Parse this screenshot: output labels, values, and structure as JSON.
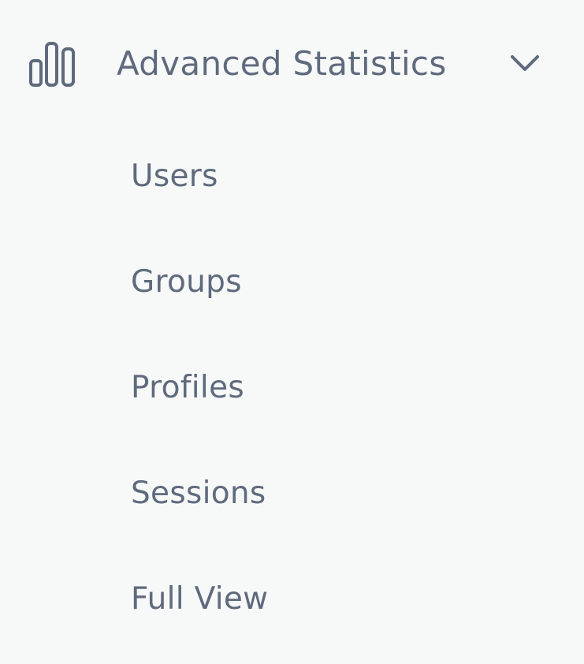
{
  "nav": {
    "section_title": "Advanced Statistics",
    "section_icon": "bar-chart-icon",
    "toggle_icon": "chevron-down-icon",
    "items": [
      {
        "label": "Users"
      },
      {
        "label": "Groups"
      },
      {
        "label": "Profiles"
      },
      {
        "label": "Sessions"
      },
      {
        "label": "Full View"
      }
    ]
  },
  "colors": {
    "background": "#f7f9f9",
    "text": "#5f6a7d",
    "icon": "#5f6a7d"
  }
}
